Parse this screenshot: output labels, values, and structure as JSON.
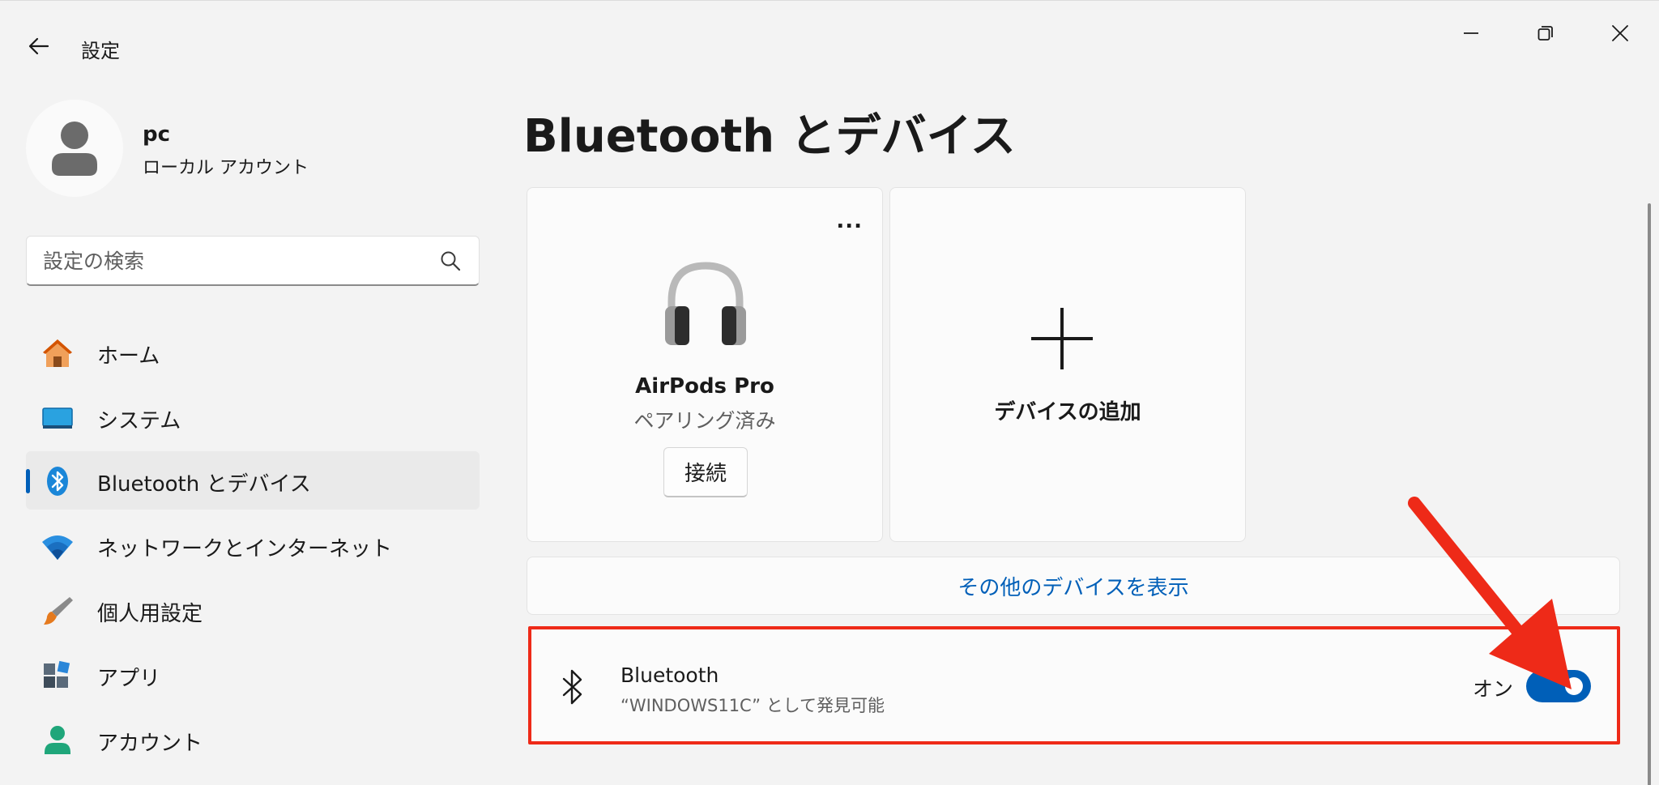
{
  "window": {
    "app_title": "設定",
    "controls": {
      "minimize_icon": "minimize-icon",
      "restore_icon": "restore-icon",
      "close_icon": "close-icon"
    }
  },
  "profile": {
    "name": "pc",
    "account_type": "ローカル アカウント"
  },
  "search": {
    "placeholder": "設定の検索"
  },
  "sidebar": {
    "items": [
      {
        "label": "ホーム",
        "icon": "home-icon"
      },
      {
        "label": "システム",
        "icon": "system-icon"
      },
      {
        "label": "Bluetooth とデバイス",
        "icon": "bluetooth-icon",
        "active": true
      },
      {
        "label": "ネットワークとインターネット",
        "icon": "wifi-icon"
      },
      {
        "label": "個人用設定",
        "icon": "brush-icon"
      },
      {
        "label": "アプリ",
        "icon": "apps-icon"
      },
      {
        "label": "アカウント",
        "icon": "account-icon"
      }
    ]
  },
  "main": {
    "page_title": "Bluetooth とデバイス",
    "device_card": {
      "more_label": "...",
      "name": "AirPods Pro",
      "status": "ペアリング済み",
      "connect_label": "接続",
      "icon": "headphones-icon"
    },
    "add_card": {
      "label": "デバイスの追加",
      "icon": "plus-icon"
    },
    "show_more_label": "その他のデバイスを表示",
    "bluetooth_row": {
      "title": "Bluetooth",
      "description": "“WINDOWS11C” として発見可能",
      "state_label": "オン",
      "enabled": true
    }
  },
  "colors": {
    "accent": "#005fb8",
    "highlight": "#ee2a18",
    "background": "#f3f3f3"
  }
}
